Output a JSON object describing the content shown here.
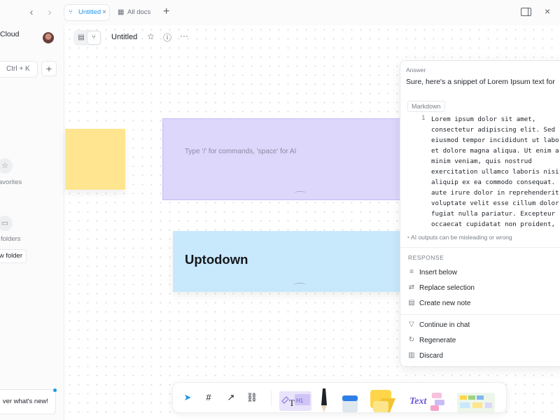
{
  "topbar": {
    "back_glyph": "‹",
    "forward_glyph": "›",
    "tabs": [
      {
        "label": "Untitled",
        "active": true
      },
      {
        "label": "All docs",
        "active": false
      }
    ],
    "new_tab_glyph": "+",
    "close_glyph": "×"
  },
  "sidebar": {
    "workspace_name": "Cloud",
    "search_shortcut": "Ctrl + K",
    "add_glyph": "+",
    "favorites_label": "avorites",
    "folders_label": "folders",
    "new_folder_label": "w folder",
    "whats_new_label": "ver what's new!",
    "more_glyph": "···"
  },
  "doc": {
    "title": "Untitled",
    "more_glyph": "···"
  },
  "notes": {
    "purple_placeholder": "Type '/' for commands, 'space' for AI",
    "blue_title": "Uptodown"
  },
  "ai_panel": {
    "answer_label": "Answer",
    "lead_text": "Sure, here's a snippet of Lorem Ipsum text for",
    "code_language": "Markdown",
    "line_number": "1",
    "code_lines": [
      "Lorem ipsum dolor sit amet,",
      "consectetur adipiscing elit. Sed",
      "eiusmod tempor incididunt ut labo",
      "et dolore magna aliqua. Ut enim a",
      "minim veniam, quis nostrud",
      "exercitation ullamco laboris nisi",
      "aliquip ex ea commodo consequat.",
      "aute irure dolor in reprehenderit",
      "voluptate velit esse cillum dolor",
      "fugiat nulla pariatur. Excepteur",
      "occaecat cupidatat non proident,"
    ],
    "disclaimer": "AI outputs can be misleading or wrong",
    "response_label": "RESPONSE",
    "response_actions": [
      {
        "label": "Insert below",
        "icon": "insert-below-icon",
        "glyph": "≡"
      },
      {
        "label": "Replace selection",
        "icon": "replace-icon",
        "glyph": "⇄"
      },
      {
        "label": "Create new note",
        "icon": "new-note-icon",
        "glyph": "▤"
      }
    ],
    "followup_actions": [
      {
        "label": "Continue in chat",
        "icon": "chat-icon",
        "glyph": "▽"
      },
      {
        "label": "Regenerate",
        "icon": "regenerate-icon",
        "glyph": "↻"
      },
      {
        "label": "Discard",
        "icon": "trash-icon",
        "glyph": "🗑"
      }
    ]
  },
  "toolbar": {
    "shape_text_label": "Text",
    "text_tool_t": "T",
    "text_tool_h1": "H1"
  },
  "colors": {
    "accent": "#1e96eb",
    "note_yellow": "#ffe58f",
    "note_purple": "#dcd7fb",
    "note_blue": "#c8e8fb"
  }
}
